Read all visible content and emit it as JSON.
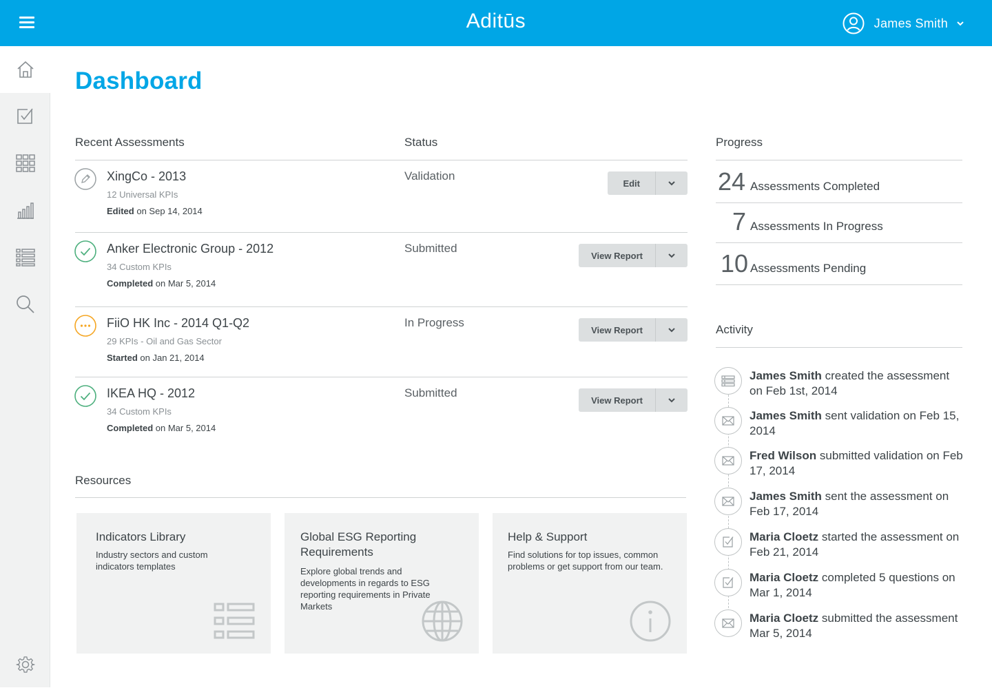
{
  "app": {
    "brand": "Aditūs",
    "accent": "#00a6e6"
  },
  "user": {
    "name": "James Smith"
  },
  "sidebar": {
    "items": [
      {
        "name": "home-icon",
        "active": true
      },
      {
        "name": "checkbox-icon",
        "active": false
      },
      {
        "name": "grid-icon",
        "active": false
      },
      {
        "name": "bar-chart-icon",
        "active": false
      },
      {
        "name": "list-icon",
        "active": false
      },
      {
        "name": "search-icon",
        "active": false
      },
      {
        "name": "gear-icon",
        "active": false
      }
    ]
  },
  "page": {
    "title": "Dashboard"
  },
  "assessments": {
    "header": "Recent Assessments",
    "status_header": "Status",
    "rows": [
      {
        "icon": "pencil-icon",
        "name": "XingCo - 2013",
        "sub": "12 Universal KPIs",
        "date_label": "Edited",
        "date_rest": " on Sep 14, 2014",
        "status": "Validation",
        "action": "Edit"
      },
      {
        "icon": "check-circle-icon",
        "name": "Anker Electronic Group - 2012",
        "sub": "34 Custom KPIs",
        "date_label": "Completed",
        "date_rest": " on Mar 5, 2014",
        "status": "Submitted",
        "action": "View Report"
      },
      {
        "icon": "ellipsis-circle-icon",
        "name": "FiiO HK Inc - 2014 Q1-Q2",
        "sub": "29 KPIs - Oil and Gas Sector",
        "date_label": "Started",
        "date_rest": " on Jan 21, 2014",
        "status": "In Progress",
        "action": "View Report"
      },
      {
        "icon": "check-circle-icon",
        "name": "IKEA HQ - 2012",
        "sub": "34 Custom KPIs",
        "date_label": "Completed",
        "date_rest": " on Mar 5, 2014",
        "status": "Submitted",
        "action": "View Report"
      }
    ]
  },
  "resources": {
    "header": "Resources",
    "cards": [
      {
        "title": "Indicators Library",
        "desc": "Industry sectors and custom indicators templates",
        "icon": "list-icon"
      },
      {
        "title": "Global ESG Reporting Requirements",
        "desc": "Explore global trends and developments in regards to ESG reporting requirements in Private Markets",
        "icon": "globe-icon"
      },
      {
        "title": "Help & Support",
        "desc": "Find solutions for top issues, common problems or get support from our team.",
        "icon": "info-icon"
      }
    ]
  },
  "progress": {
    "header": "Progress",
    "items": [
      {
        "num": "24",
        "label": "Assessments Completed"
      },
      {
        "num": "7",
        "label": "Assessments In Progress"
      },
      {
        "num": "10",
        "label": "Assessments Pending"
      }
    ]
  },
  "activity": {
    "header": "Activity",
    "items": [
      {
        "icon": "list-icon",
        "who": "James Smith",
        "text": " created the assessment on Feb 1st, 2014"
      },
      {
        "icon": "envelope-icon",
        "who": "James Smith",
        "text": " sent validation on Feb 15, 2014"
      },
      {
        "icon": "envelope-icon",
        "who": "Fred Wilson",
        "text": " submitted validation on Feb 17, 2014"
      },
      {
        "icon": "envelope-icon",
        "who": "James Smith",
        "text": " sent the assessment on Feb 17, 2014"
      },
      {
        "icon": "checkbox-icon",
        "who": "Maria Cloetz",
        "text": " started the assessment on Feb 21, 2014"
      },
      {
        "icon": "checkbox-icon",
        "who": "Maria Cloetz",
        "text": " completed 5 questions on Mar 1, 2014"
      },
      {
        "icon": "envelope-icon",
        "who": "Maria Cloetz",
        "text": " submitted the assessment Mar 5, 2014"
      }
    ]
  }
}
